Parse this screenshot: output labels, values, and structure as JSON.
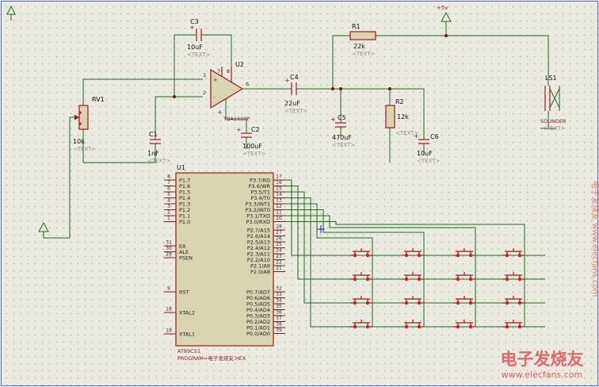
{
  "symbols": {
    "plus": "+",
    "minus": "-"
  },
  "power": {
    "vcc_label": "+5v"
  },
  "components": {
    "c1": {
      "ref": "C1",
      "value": "1nF",
      "placeholder": "<TEXT>"
    },
    "c2": {
      "ref": "C2",
      "value": "100uF",
      "placeholder": "<TEXT>"
    },
    "c3": {
      "ref": "C3",
      "value": "10uF",
      "placeholder": "<TEXT>"
    },
    "c4": {
      "ref": "C4",
      "value": "22uF",
      "placeholder": "<TEXT>"
    },
    "c5": {
      "ref": "C5",
      "value": "470uF",
      "placeholder": "<TEXT>"
    },
    "c6": {
      "ref": "C6",
      "value": "10uF",
      "placeholder": "<TEXT>"
    },
    "r1": {
      "ref": "R1",
      "value": "22k",
      "placeholder": "<TEXT>"
    },
    "r2": {
      "ref": "R2",
      "value": "12k",
      "placeholder": "<TEXT>"
    },
    "rv1": {
      "ref": "RV1",
      "value": "10k",
      "placeholder": "<TEXT>"
    },
    "ls1": {
      "ref": "LS1",
      "part": "SOUNDER",
      "placeholder": "<TEXT>"
    },
    "u2": {
      "ref": "U2",
      "part": "TBA1120P",
      "pin_in_plus": "3",
      "pin_in_minus": "2",
      "pin_out": "6",
      "pin_top_left": "7",
      "pin_top_right": "8"
    }
  },
  "u1": {
    "ref": "U1",
    "part": "AT89C51",
    "program": "PROGRAM=电子发烧友.HEX",
    "p1": [
      {
        "name": "P1.7",
        "num": "8"
      },
      {
        "name": "P1.6",
        "num": "7"
      },
      {
        "name": "P1.5",
        "num": "6"
      },
      {
        "name": "P1.4",
        "num": "5"
      },
      {
        "name": "P1.3",
        "num": "4"
      },
      {
        "name": "P1.2",
        "num": "3"
      },
      {
        "name": "P1.1",
        "num": "2"
      },
      {
        "name": "P1.0",
        "num": "1"
      }
    ],
    "ctrl": [
      {
        "name": "EA",
        "num": "31"
      },
      {
        "name": "ALE",
        "num": "30"
      },
      {
        "name": "PSEN",
        "num": "29"
      }
    ],
    "rst": [
      {
        "name": "RST",
        "num": "9"
      }
    ],
    "xtal": [
      {
        "name": "XTAL2",
        "num": "18"
      },
      {
        "name": "XTAL1",
        "num": "19"
      }
    ],
    "p3": [
      {
        "name": "P3.7/RD",
        "num": "17"
      },
      {
        "name": "P3.6/WR",
        "num": "16"
      },
      {
        "name": "P3.5/T1",
        "num": "15"
      },
      {
        "name": "P3.4/T0",
        "num": "14"
      },
      {
        "name": "P3.3/INT1",
        "num": "13"
      },
      {
        "name": "P3.2/INT0",
        "num": "12"
      },
      {
        "name": "P3.1/TXD",
        "num": "11"
      },
      {
        "name": "P3.0/RXD",
        "num": "10"
      }
    ],
    "p2": [
      {
        "name": "P2.7/A15",
        "num": "28"
      },
      {
        "name": "P2.6/A14",
        "num": "27"
      },
      {
        "name": "P2.5/A13",
        "num": "26"
      },
      {
        "name": "P2.4/A12",
        "num": "25"
      },
      {
        "name": "P2.3/A11",
        "num": "24"
      },
      {
        "name": "P2.2/A10",
        "num": "23"
      },
      {
        "name": "P2.1/A9",
        "num": "22"
      },
      {
        "name": "P2.0/A8",
        "num": "21"
      }
    ],
    "p0": [
      {
        "name": "P0.7/AD7",
        "num": "32"
      },
      {
        "name": "P0.6/AD6",
        "num": "33"
      },
      {
        "name": "P0.5/AD5",
        "num": "34"
      },
      {
        "name": "P0.4/AD4",
        "num": "35"
      },
      {
        "name": "P0.3/AD3",
        "num": "36"
      },
      {
        "name": "P0.2/AD2",
        "num": "37"
      },
      {
        "name": "P0.1/AD1",
        "num": "38"
      },
      {
        "name": "P0.0/AD0",
        "num": "39"
      }
    ]
  },
  "keypad": {
    "rows": 4,
    "cols": 4
  },
  "watermark": {
    "brand": "电子发烧友",
    "url": "www.elecfans.com",
    "side": "电子发烧友 www.elecfans.com"
  },
  "colors": {
    "wire_green": "#1b6e1b",
    "component_red": "#a01818",
    "chip_fill": "#d9d5b0",
    "background": "#eaeae1",
    "watermark_red": "#df4848",
    "sheet_border_blue": "#5a6fd6"
  }
}
